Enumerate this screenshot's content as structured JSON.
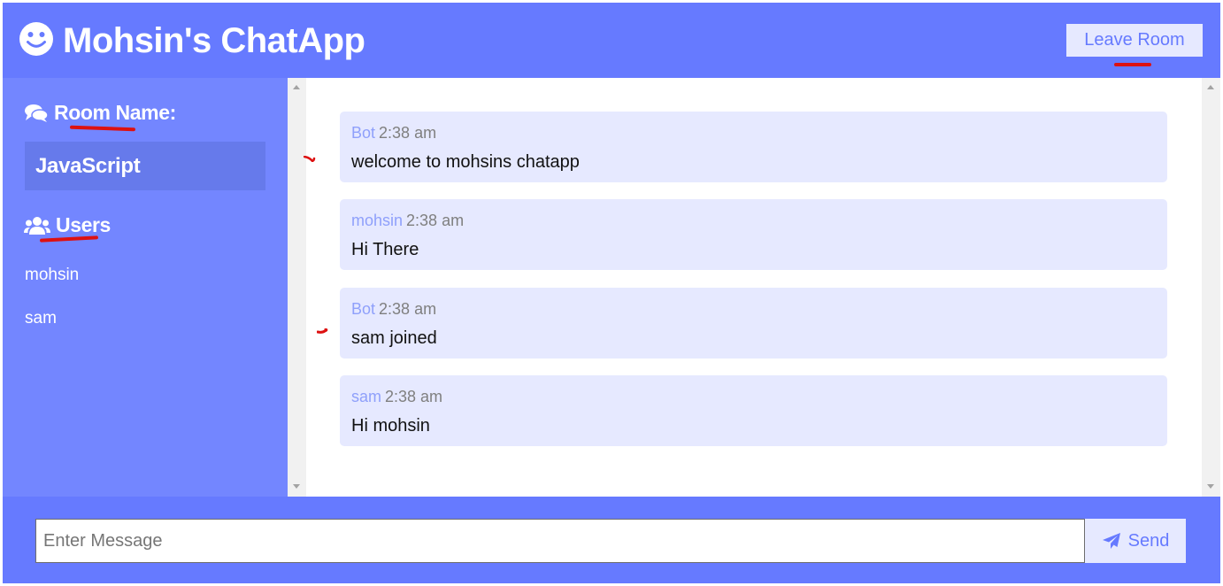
{
  "header": {
    "app_title": "Mohsin's ChatApp",
    "logo_icon": "smiley-face-icon",
    "leave_label": "Leave Room"
  },
  "sidebar": {
    "room_heading": "Room Name:",
    "room_heading_icon": "comments-icon",
    "room_name": "JavaScript",
    "users_heading": "Users",
    "users_heading_icon": "users-icon",
    "users": [
      "mohsin",
      "sam"
    ]
  },
  "messages": [
    {
      "user": "Bot",
      "time": "2:38 am",
      "text": "welcome to mohsins chatapp"
    },
    {
      "user": "mohsin",
      "time": "2:38 am",
      "text": "Hi There"
    },
    {
      "user": "Bot",
      "time": "2:38 am",
      "text": "sam joined"
    },
    {
      "user": "sam",
      "time": "2:38 am",
      "text": "Hi mohsin"
    }
  ],
  "composer": {
    "placeholder": "Enter Message",
    "value": "",
    "send_label": "Send",
    "send_icon": "paper-plane-icon"
  },
  "colors": {
    "primary": "#667aff",
    "sidebar": "#7386ff",
    "room_box": "#667aeb",
    "light": "#e6e9ff",
    "username": "#8fa0fb",
    "annotation_red": "#dd1111"
  }
}
